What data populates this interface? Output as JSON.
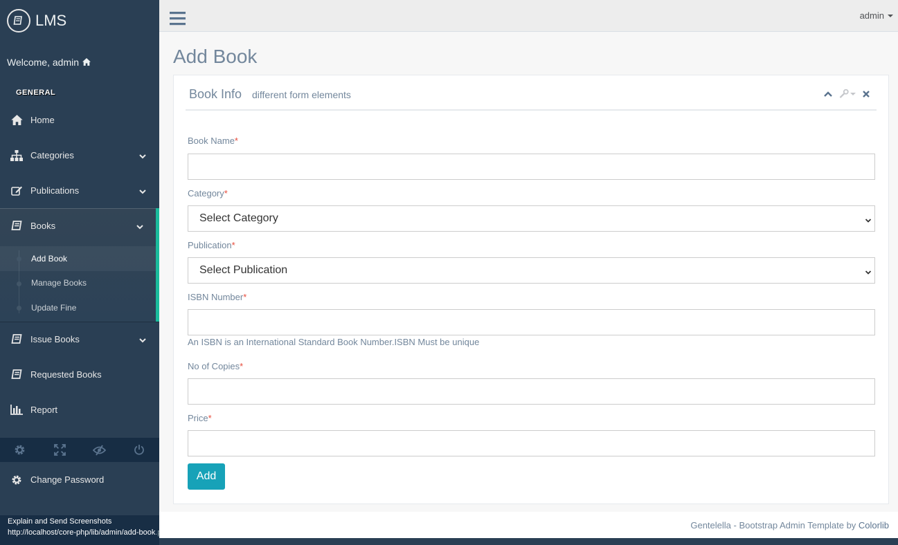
{
  "brand": {
    "title": "LMS",
    "icon": "book-icon"
  },
  "welcome": {
    "text": "Welcome, admin",
    "icon": "home-icon"
  },
  "sidebar": {
    "section_title": "GENERAL",
    "items": [
      {
        "label": "Home",
        "icon": "home-icon"
      },
      {
        "label": "Categories",
        "icon": "sitemap-icon"
      },
      {
        "label": "Publications",
        "icon": "edit-icon"
      },
      {
        "label": "Books",
        "icon": "book-icon",
        "expanded": true
      },
      {
        "label": "Issue Books",
        "icon": "book-icon"
      },
      {
        "label": "Requested Books",
        "icon": "book-icon"
      },
      {
        "label": "Report",
        "icon": "bar-chart-icon"
      }
    ],
    "books_children": [
      {
        "label": "Add Book",
        "active": true
      },
      {
        "label": "Manage Books"
      },
      {
        "label": "Update Fine"
      }
    ],
    "footer_icons": [
      "settings-icon",
      "fullscreen-icon",
      "eye-slash-icon",
      "power-icon"
    ],
    "change_password": {
      "label": "Change Password",
      "icon": "gear-icon"
    }
  },
  "status_bar": {
    "line1": "Explain and Send Screenshots",
    "line2": "http://localhost/core-php/lib/admin/add-book",
    "line2_suffix": ".php"
  },
  "top_nav": {
    "user": "admin"
  },
  "page": {
    "title": "Add Book",
    "panel_title": "Book Info",
    "panel_subtitle": "different form elements",
    "form": {
      "book_name_label": "Book Name",
      "category_label": "Category",
      "category_selected": "Select Category",
      "publication_label": "Publication",
      "publication_selected": "Select Publication",
      "isbn_label": "ISBN Number",
      "isbn_help": "An ISBN is an International Standard Book Number.ISBN Must be unique",
      "copies_label": "No of Copies",
      "price_label": "Price",
      "required_mark": "*",
      "submit_label": "Add"
    }
  },
  "footer": {
    "text": "Gentelella - Bootstrap Admin Template by ",
    "link": "Colorlib"
  },
  "colors": {
    "sidebar_bg": "#2A3F54",
    "accent": "#1ABB9C",
    "button": "#17A2B8",
    "required": "#E74C3C"
  }
}
